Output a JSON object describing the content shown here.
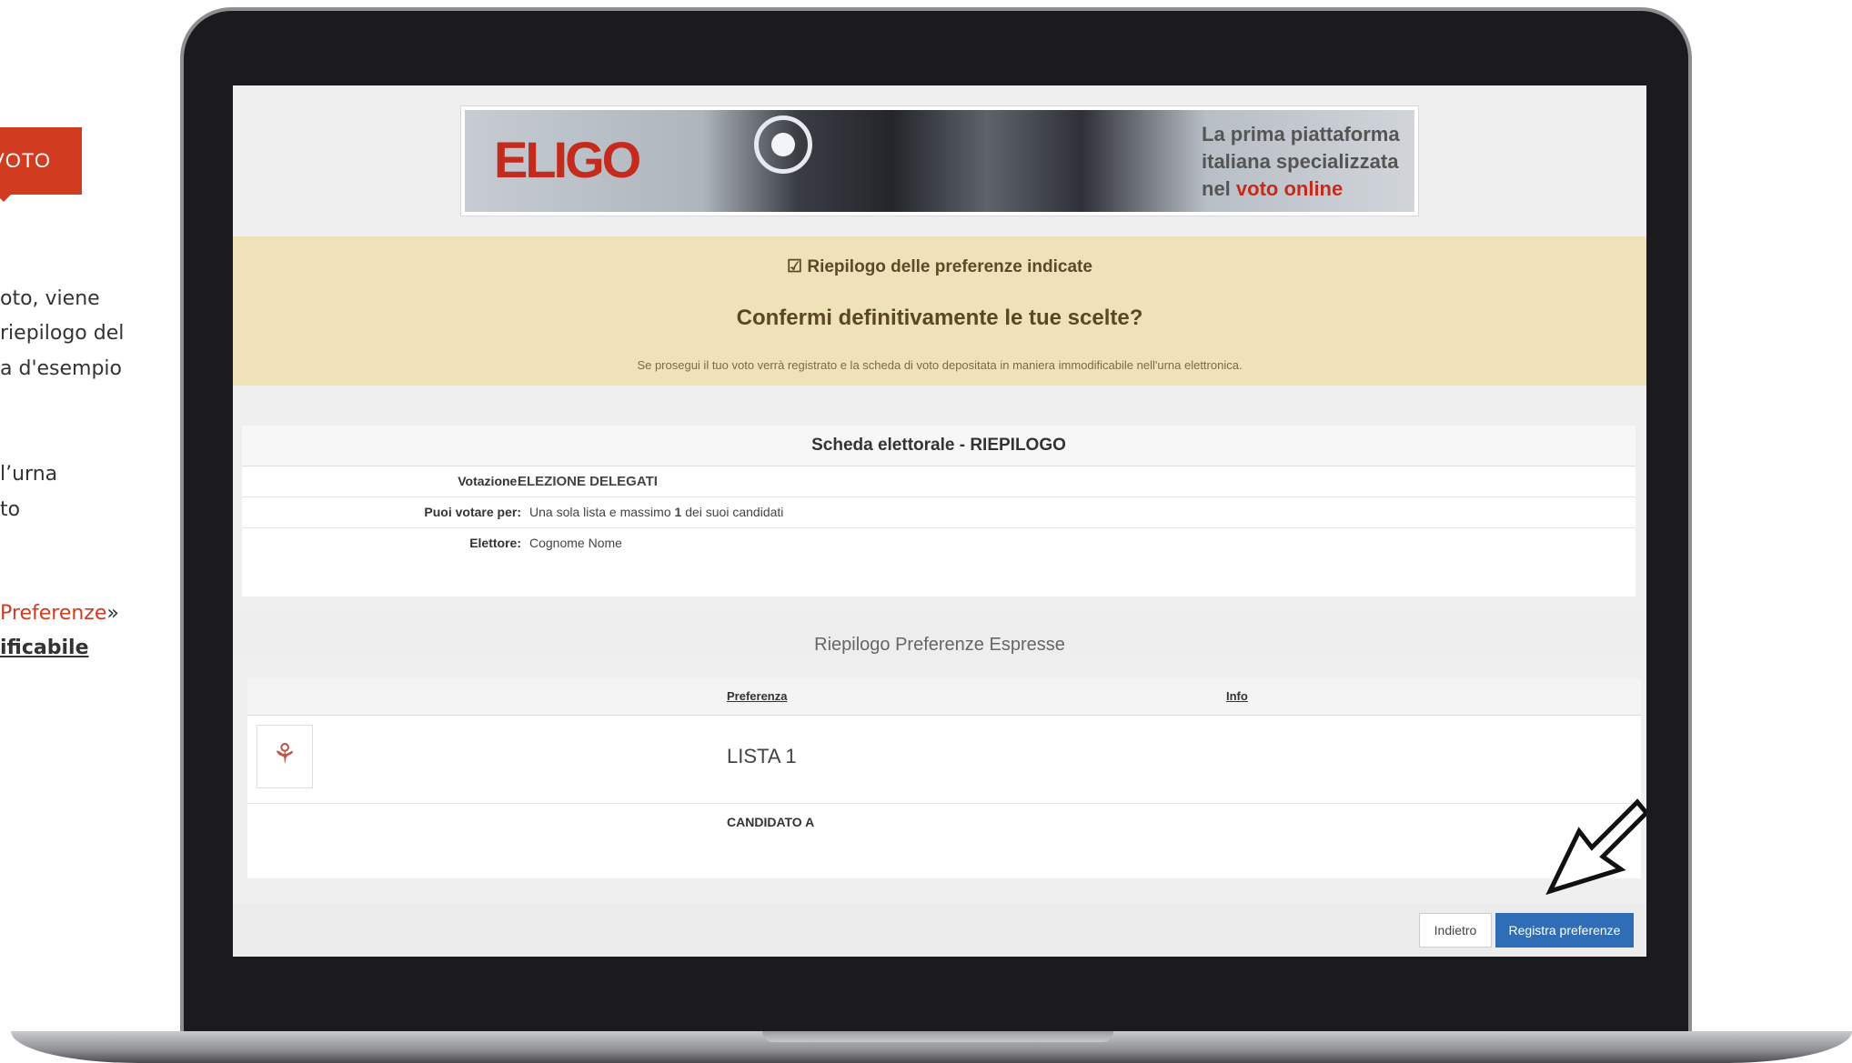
{
  "left_panel": {
    "tag": "VOTO",
    "lines": [
      "oto, viene",
      "riepilogo del",
      "a d'esempio",
      "l’urna",
      "to"
    ],
    "preferenze_red": "Preferenze",
    "preferenze_tail": "»",
    "bold_word": "ificabile"
  },
  "banner": {
    "logo": "ELIGO",
    "tagline_line1": "La prima piattaforma",
    "tagline_line2": "italiana specializzata",
    "tagline_line3_prefix": "nel ",
    "tagline_line3_red": "voto online"
  },
  "confirm": {
    "header": "☑ Riepilogo delle preferenze indicate",
    "question": "Confermi definitivamente le tue scelte?",
    "note": "Se prosegui il tuo voto verrà registrato e la scheda di voto depositata in maniera immodificabile nell'urna elettronica."
  },
  "ballot": {
    "title": "Scheda elettorale - RIEPILOGO",
    "rows": [
      {
        "key": "Votazione:",
        "value": "ELEZIONE DELEGATI"
      },
      {
        "key": "Puoi votare per:",
        "value_prefix": "Una sola lista e massimo ",
        "value_bold": "1",
        "value_suffix": " dei suoi candidati"
      },
      {
        "key": "Elettore:",
        "value": "Cognome Nome"
      }
    ]
  },
  "summary": {
    "title": "Riepilogo Preferenze Espresse",
    "col_preferenza": "Preferenza",
    "col_info": "Info",
    "list_name": "LISTA 1",
    "candidate": "CANDIDATO A"
  },
  "buttons": {
    "back": "Indietro",
    "save": "Registra preferenze"
  },
  "colors": {
    "accent_red": "#d13b1f",
    "confirm_bg": "#efe2b8",
    "primary_button": "#2f6eb6"
  }
}
